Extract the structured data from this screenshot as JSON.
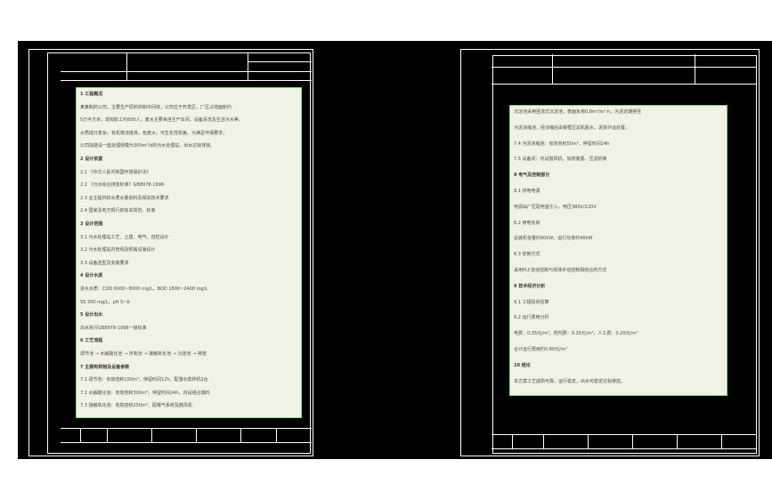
{
  "left_sheet": {
    "lines": [
      {
        "text": "1  工程概况",
        "heading": true
      },
      {
        "text": "    某某制药公司，主要生产原料药和中间体，公司位于开发区，厂区占地面积约"
      },
      {
        "text": "5万平方米，现有职工约800人，废水主要来自生产车间、设备清洗及生活污水等，"
      },
      {
        "text": "水质成分复杂，有机物浓度高，色度大，可生化性较差。为满足环保要求，"
      },
      {
        "text": "公司拟建设一座处理规模为300m³/d的污水处理站，出水达标排放。"
      },
      {
        "text": "2  设计依据",
        "heading": true
      },
      {
        "text": "2.1 《中华人民共和国环境保护法》"
      },
      {
        "text": "2.2 《污水综合排放标准》GB8978-1996"
      },
      {
        "text": "2.3 业主提供的水质水量资料及相关技术要求"
      },
      {
        "text": "2.4 国家及地方现行的有关规范、标准"
      },
      {
        "text": "3  设计范围",
        "heading": true
      },
      {
        "text": "3.1 污水处理站工艺、土建、电气、自控设计"
      },
      {
        "text": "3.2 污水处理站内管线及附属设施设计"
      },
      {
        "text": "3.3 设备选型及安装要求"
      },
      {
        "text": "4  设计水质",
        "heading": true
      },
      {
        "text": "    进水水质：COD 6000~8000 mg/L，BOD 1800~2400 mg/L"
      },
      {
        "text": "    SS 300 mg/L，pH 5~6"
      },
      {
        "text": "5  设计出水",
        "heading": true
      },
      {
        "text": "    出水执行GB8978-1996一级标准"
      },
      {
        "text": "6  工艺流程",
        "heading": true
      },
      {
        "text": "    调节池 → 水解酸化池 → 厌氧池 → 接触氧化池 → 沉淀池 → 排放"
      },
      {
        "text": "7  主要构筑物及设备参数",
        "heading": true
      },
      {
        "text": "7.1 调节池：有效容积150m³，停留时间12h，配潜水搅拌机2台"
      },
      {
        "text": "7.2 水解酸化池：有效容积300m³，停留时间24h，内设组合填料"
      },
      {
        "text": "7.3 接触氧化池：有效容积250m³，配曝气系统及鼓风机"
      }
    ]
  },
  "right_sheet": {
    "lines": [
      {
        "text": "    沉淀池采用竖流式沉淀池，表面负荷0.8m³/m²·h，污泥定期排至"
      },
      {
        "text": "污泥浓缩池，经浓缩后由板框压滤机脱水，泥饼外运处置。"
      },
      {
        "text": "7.4 污泥浓缩池：有效容积50m³，停留时间24h"
      },
      {
        "text": "7.5 设备间：内设鼓风机、加药装置、压滤机等"
      },
      {
        "text": "8  电气及控制部分",
        "heading": true
      },
      {
        "text": "8.1 供电电源"
      },
      {
        "text": "    电源由厂区配电室引入，电压380V/220V"
      },
      {
        "text": "8.2 用电负荷"
      },
      {
        "text": "    总装机容量约60kW，运行功率约40kW"
      },
      {
        "text": "8.3 控制方式"
      },
      {
        "text": "    采用PLC自动控制与现场手动控制相结合的方式"
      },
      {
        "text": "9  技术经济分析",
        "heading": true
      },
      {
        "text": "9.1 工程投资估算"
      },
      {
        "text": "9.2 运行费用分析"
      },
      {
        "text": "    电费：0.35元/m³，药剂费：0.25元/m³，人工费：0.20元/m³"
      },
      {
        "text": "    合计运行费用约0.80元/m³"
      },
      {
        "text": "10  结论",
        "heading": true
      },
      {
        "text": "    本方案工艺成熟可靠，运行稳定，出水可稳定达标排放。"
      }
    ]
  }
}
